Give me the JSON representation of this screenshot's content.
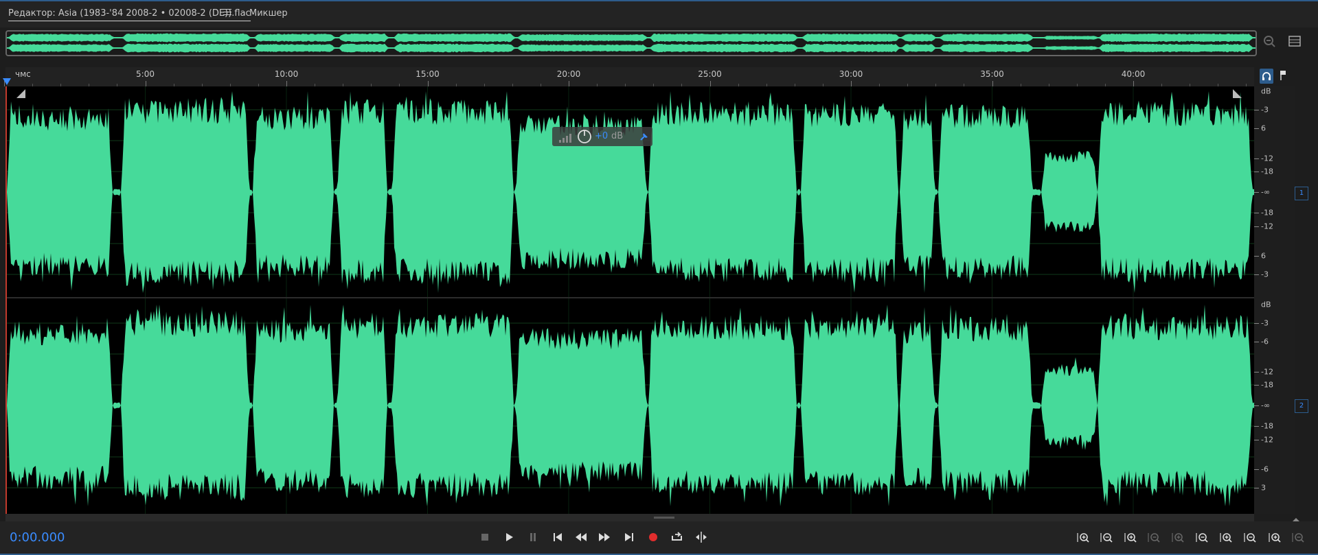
{
  "tabs": [
    {
      "label": "Редактор: Asia (1983-'84 2008-2 • 02008-2 (DE)).flac",
      "active": true
    },
    {
      "label": "Микшер",
      "active": false
    }
  ],
  "ruler": {
    "unit_label": "чмс",
    "ticks": [
      "5:00",
      "10:00",
      "15:00",
      "20:00",
      "25:00",
      "30:00",
      "35:00",
      "40:00"
    ]
  },
  "channels": [
    {
      "number": "1",
      "db_header": "dB",
      "db_labels": [
        "-3",
        "6",
        "-12",
        "-18",
        "-∞",
        "-18",
        "-12",
        "6",
        "-3"
      ]
    },
    {
      "number": "2",
      "db_header": "dB",
      "db_labels": [
        "-3",
        "-6",
        "-12",
        "-18",
        "-∞",
        "-18",
        "-12",
        "-6",
        "3"
      ]
    }
  ],
  "hud": {
    "value": "+0",
    "unit": "dB"
  },
  "timecode": "0:00.000",
  "colors": {
    "waveform": "#46da9a",
    "accent": "#3a8cff",
    "record": "#e12d2d"
  },
  "transport": [
    {
      "name": "stop-button",
      "icon": "stop-icon"
    },
    {
      "name": "play-button",
      "icon": "play-icon"
    },
    {
      "name": "pause-button",
      "icon": "pause-icon"
    },
    {
      "name": "go-to-start-button",
      "icon": "skip-back-icon"
    },
    {
      "name": "rewind-button",
      "icon": "rewind-icon"
    },
    {
      "name": "fast-forward-button",
      "icon": "fast-forward-icon"
    },
    {
      "name": "go-to-end-button",
      "icon": "skip-forward-icon"
    },
    {
      "name": "record-button",
      "icon": "record-icon"
    },
    {
      "name": "loop-playback-button",
      "icon": "loop-icon"
    },
    {
      "name": "skip-selection-button",
      "icon": "skip-selection-icon"
    }
  ],
  "zoom_tools": [
    {
      "name": "zoom-in-amplitude-button",
      "icon": "zoom-in-amplitude-icon"
    },
    {
      "name": "zoom-out-amplitude-button",
      "icon": "zoom-out-amplitude-icon"
    },
    {
      "name": "zoom-in-time-button",
      "icon": "zoom-in-time-icon"
    },
    {
      "name": "zoom-out-time-button",
      "icon": "zoom-out-time-icon"
    },
    {
      "name": "zoom-out-full-button",
      "icon": "zoom-out-full-icon"
    },
    {
      "name": "zoom-in-at-in-point-button",
      "icon": "zoom-in-point-icon"
    },
    {
      "name": "zoom-in-at-out-point-button",
      "icon": "zoom-out-point-icon"
    },
    {
      "name": "zoom-to-selection-button",
      "icon": "zoom-selection-icon"
    },
    {
      "name": "zoom-reset-button",
      "icon": "zoom-reset-icon"
    },
    {
      "name": "zoom-disabled-button",
      "icon": "zoom-disabled-icon"
    }
  ]
}
